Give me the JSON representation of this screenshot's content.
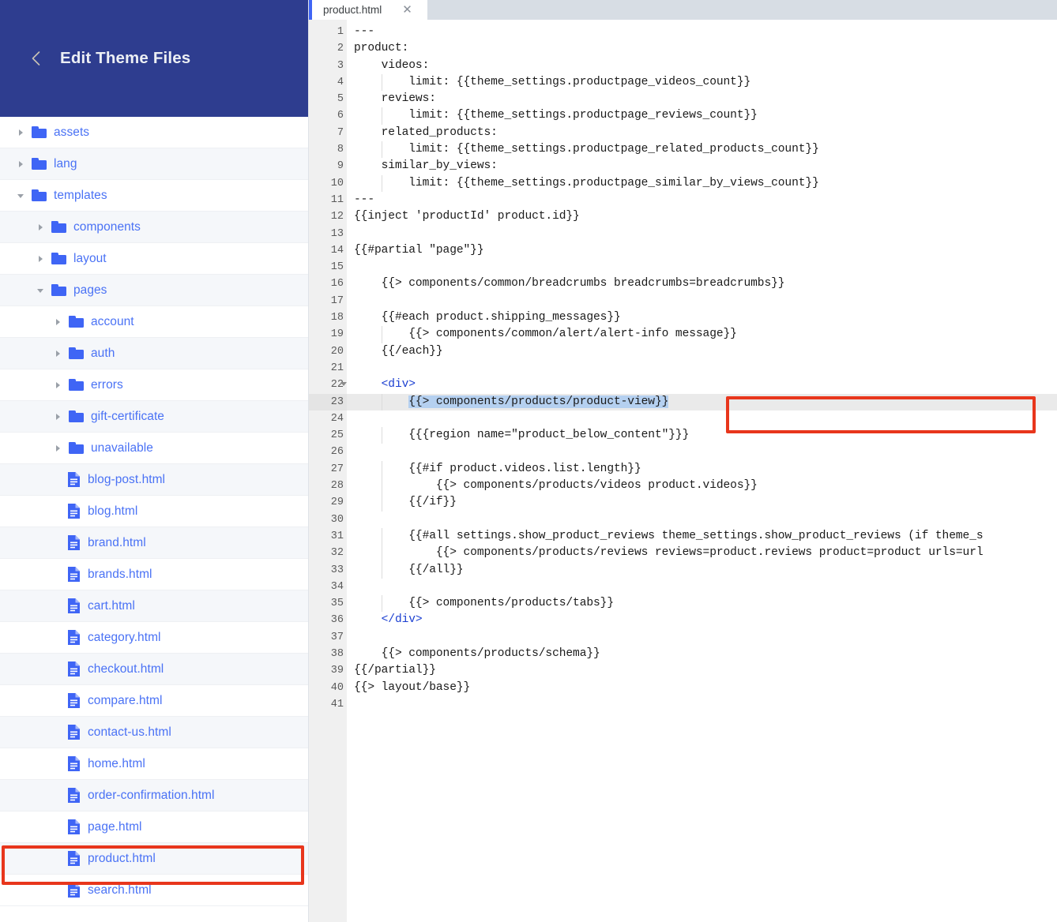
{
  "sidebar": {
    "header": {
      "title": "Edit Theme Files",
      "back_icon": "chevron-left-icon"
    },
    "tree": [
      {
        "label": "assets",
        "type": "folder",
        "level": 0,
        "state": "closed"
      },
      {
        "label": "lang",
        "type": "folder",
        "level": 0,
        "state": "closed"
      },
      {
        "label": "templates",
        "type": "folder",
        "level": 0,
        "state": "open"
      },
      {
        "label": "components",
        "type": "folder",
        "level": 1,
        "state": "closed"
      },
      {
        "label": "layout",
        "type": "folder",
        "level": 1,
        "state": "closed"
      },
      {
        "label": "pages",
        "type": "folder",
        "level": 1,
        "state": "open"
      },
      {
        "label": "account",
        "type": "folder",
        "level": 2,
        "state": "closed"
      },
      {
        "label": "auth",
        "type": "folder",
        "level": 2,
        "state": "closed"
      },
      {
        "label": "errors",
        "type": "folder",
        "level": 2,
        "state": "closed"
      },
      {
        "label": "gift-certificate",
        "type": "folder",
        "level": 2,
        "state": "closed"
      },
      {
        "label": "unavailable",
        "type": "folder",
        "level": 2,
        "state": "closed"
      },
      {
        "label": "blog-post.html",
        "type": "file",
        "level": 2,
        "state": "none"
      },
      {
        "label": "blog.html",
        "type": "file",
        "level": 2,
        "state": "none"
      },
      {
        "label": "brand.html",
        "type": "file",
        "level": 2,
        "state": "none"
      },
      {
        "label": "brands.html",
        "type": "file",
        "level": 2,
        "state": "none"
      },
      {
        "label": "cart.html",
        "type": "file",
        "level": 2,
        "state": "none"
      },
      {
        "label": "category.html",
        "type": "file",
        "level": 2,
        "state": "none"
      },
      {
        "label": "checkout.html",
        "type": "file",
        "level": 2,
        "state": "none"
      },
      {
        "label": "compare.html",
        "type": "file",
        "level": 2,
        "state": "none"
      },
      {
        "label": "contact-us.html",
        "type": "file",
        "level": 2,
        "state": "none"
      },
      {
        "label": "home.html",
        "type": "file",
        "level": 2,
        "state": "none"
      },
      {
        "label": "order-confirmation.html",
        "type": "file",
        "level": 2,
        "state": "none"
      },
      {
        "label": "page.html",
        "type": "file",
        "level": 2,
        "state": "none"
      },
      {
        "label": "product.html",
        "type": "file",
        "level": 2,
        "state": "none"
      },
      {
        "label": "search.html",
        "type": "file",
        "level": 2,
        "state": "none"
      }
    ],
    "annotation": {
      "target": "product.html",
      "color": "#e8361c"
    }
  },
  "editor": {
    "tab": {
      "label": "product.html",
      "close_icon": "close-icon",
      "active": true
    },
    "selection": {
      "line": 23,
      "text": "{{> components/products/product-view}}",
      "highlight_color": "#b5d0f0"
    },
    "annotation": {
      "target_line": 23,
      "color": "#e8361c"
    },
    "lines": [
      {
        "n": 1,
        "text": "---",
        "indent": 0
      },
      {
        "n": 2,
        "text": "product:",
        "indent": 0
      },
      {
        "n": 3,
        "text": "    videos:",
        "indent": 0
      },
      {
        "n": 4,
        "text": "        limit: {{theme_settings.productpage_videos_count}}",
        "indent": 1
      },
      {
        "n": 5,
        "text": "    reviews:",
        "indent": 0
      },
      {
        "n": 6,
        "text": "        limit: {{theme_settings.productpage_reviews_count}}",
        "indent": 1
      },
      {
        "n": 7,
        "text": "    related_products:",
        "indent": 0
      },
      {
        "n": 8,
        "text": "        limit: {{theme_settings.productpage_related_products_count}}",
        "indent": 1
      },
      {
        "n": 9,
        "text": "    similar_by_views:",
        "indent": 0
      },
      {
        "n": 10,
        "text": "        limit: {{theme_settings.productpage_similar_by_views_count}}",
        "indent": 1
      },
      {
        "n": 11,
        "text": "---",
        "indent": 0
      },
      {
        "n": 12,
        "text": "{{inject 'productId' product.id}}",
        "indent": 0
      },
      {
        "n": 13,
        "text": "",
        "indent": 0
      },
      {
        "n": 14,
        "text": "{{#partial \"page\"}}",
        "indent": 0
      },
      {
        "n": 15,
        "text": "",
        "indent": 0
      },
      {
        "n": 16,
        "text": "    {{> components/common/breadcrumbs breadcrumbs=breadcrumbs}}",
        "indent": 0
      },
      {
        "n": 17,
        "text": "",
        "indent": 0
      },
      {
        "n": 18,
        "text": "    {{#each product.shipping_messages}}",
        "indent": 0
      },
      {
        "n": 19,
        "text": "        {{> components/common/alert/alert-info message}}",
        "indent": 1
      },
      {
        "n": 20,
        "text": "    {{/each}}",
        "indent": 0
      },
      {
        "n": 21,
        "text": "",
        "indent": 0
      },
      {
        "n": 22,
        "text": "    <div>",
        "indent": 0,
        "tag": true,
        "foldable": true
      },
      {
        "n": 23,
        "text": "        {{> components/products/product-view}}",
        "indent": 1,
        "selected": true,
        "current": true
      },
      {
        "n": 24,
        "text": "",
        "indent": 0
      },
      {
        "n": 25,
        "text": "        {{{region name=\"product_below_content\"}}}",
        "indent": 1
      },
      {
        "n": 26,
        "text": "",
        "indent": 0
      },
      {
        "n": 27,
        "text": "        {{#if product.videos.list.length}}",
        "indent": 1
      },
      {
        "n": 28,
        "text": "            {{> components/products/videos product.videos}}",
        "indent": 1
      },
      {
        "n": 29,
        "text": "        {{/if}}",
        "indent": 1
      },
      {
        "n": 30,
        "text": "",
        "indent": 0
      },
      {
        "n": 31,
        "text": "        {{#all settings.show_product_reviews theme_settings.show_product_reviews (if theme_s",
        "indent": 1
      },
      {
        "n": 32,
        "text": "            {{> components/products/reviews reviews=product.reviews product=product urls=url",
        "indent": 1
      },
      {
        "n": 33,
        "text": "        {{/all}}",
        "indent": 1
      },
      {
        "n": 34,
        "text": "",
        "indent": 0
      },
      {
        "n": 35,
        "text": "        {{> components/products/tabs}}",
        "indent": 1
      },
      {
        "n": 36,
        "text": "    </div>",
        "indent": 0,
        "tag": true
      },
      {
        "n": 37,
        "text": "",
        "indent": 0
      },
      {
        "n": 38,
        "text": "    {{> components/products/schema}}",
        "indent": 0
      },
      {
        "n": 39,
        "text": "{{/partial}}",
        "indent": 0
      },
      {
        "n": 40,
        "text": "{{> layout/base}}",
        "indent": 0
      },
      {
        "n": 41,
        "text": "",
        "indent": 0
      }
    ]
  },
  "colors": {
    "header_bg": "#2e3d8f",
    "link_blue": "#4a72f5",
    "accent_red": "#e8361c",
    "tag_blue": "#1b3fd1",
    "selection_blue": "#b5d0f0"
  }
}
